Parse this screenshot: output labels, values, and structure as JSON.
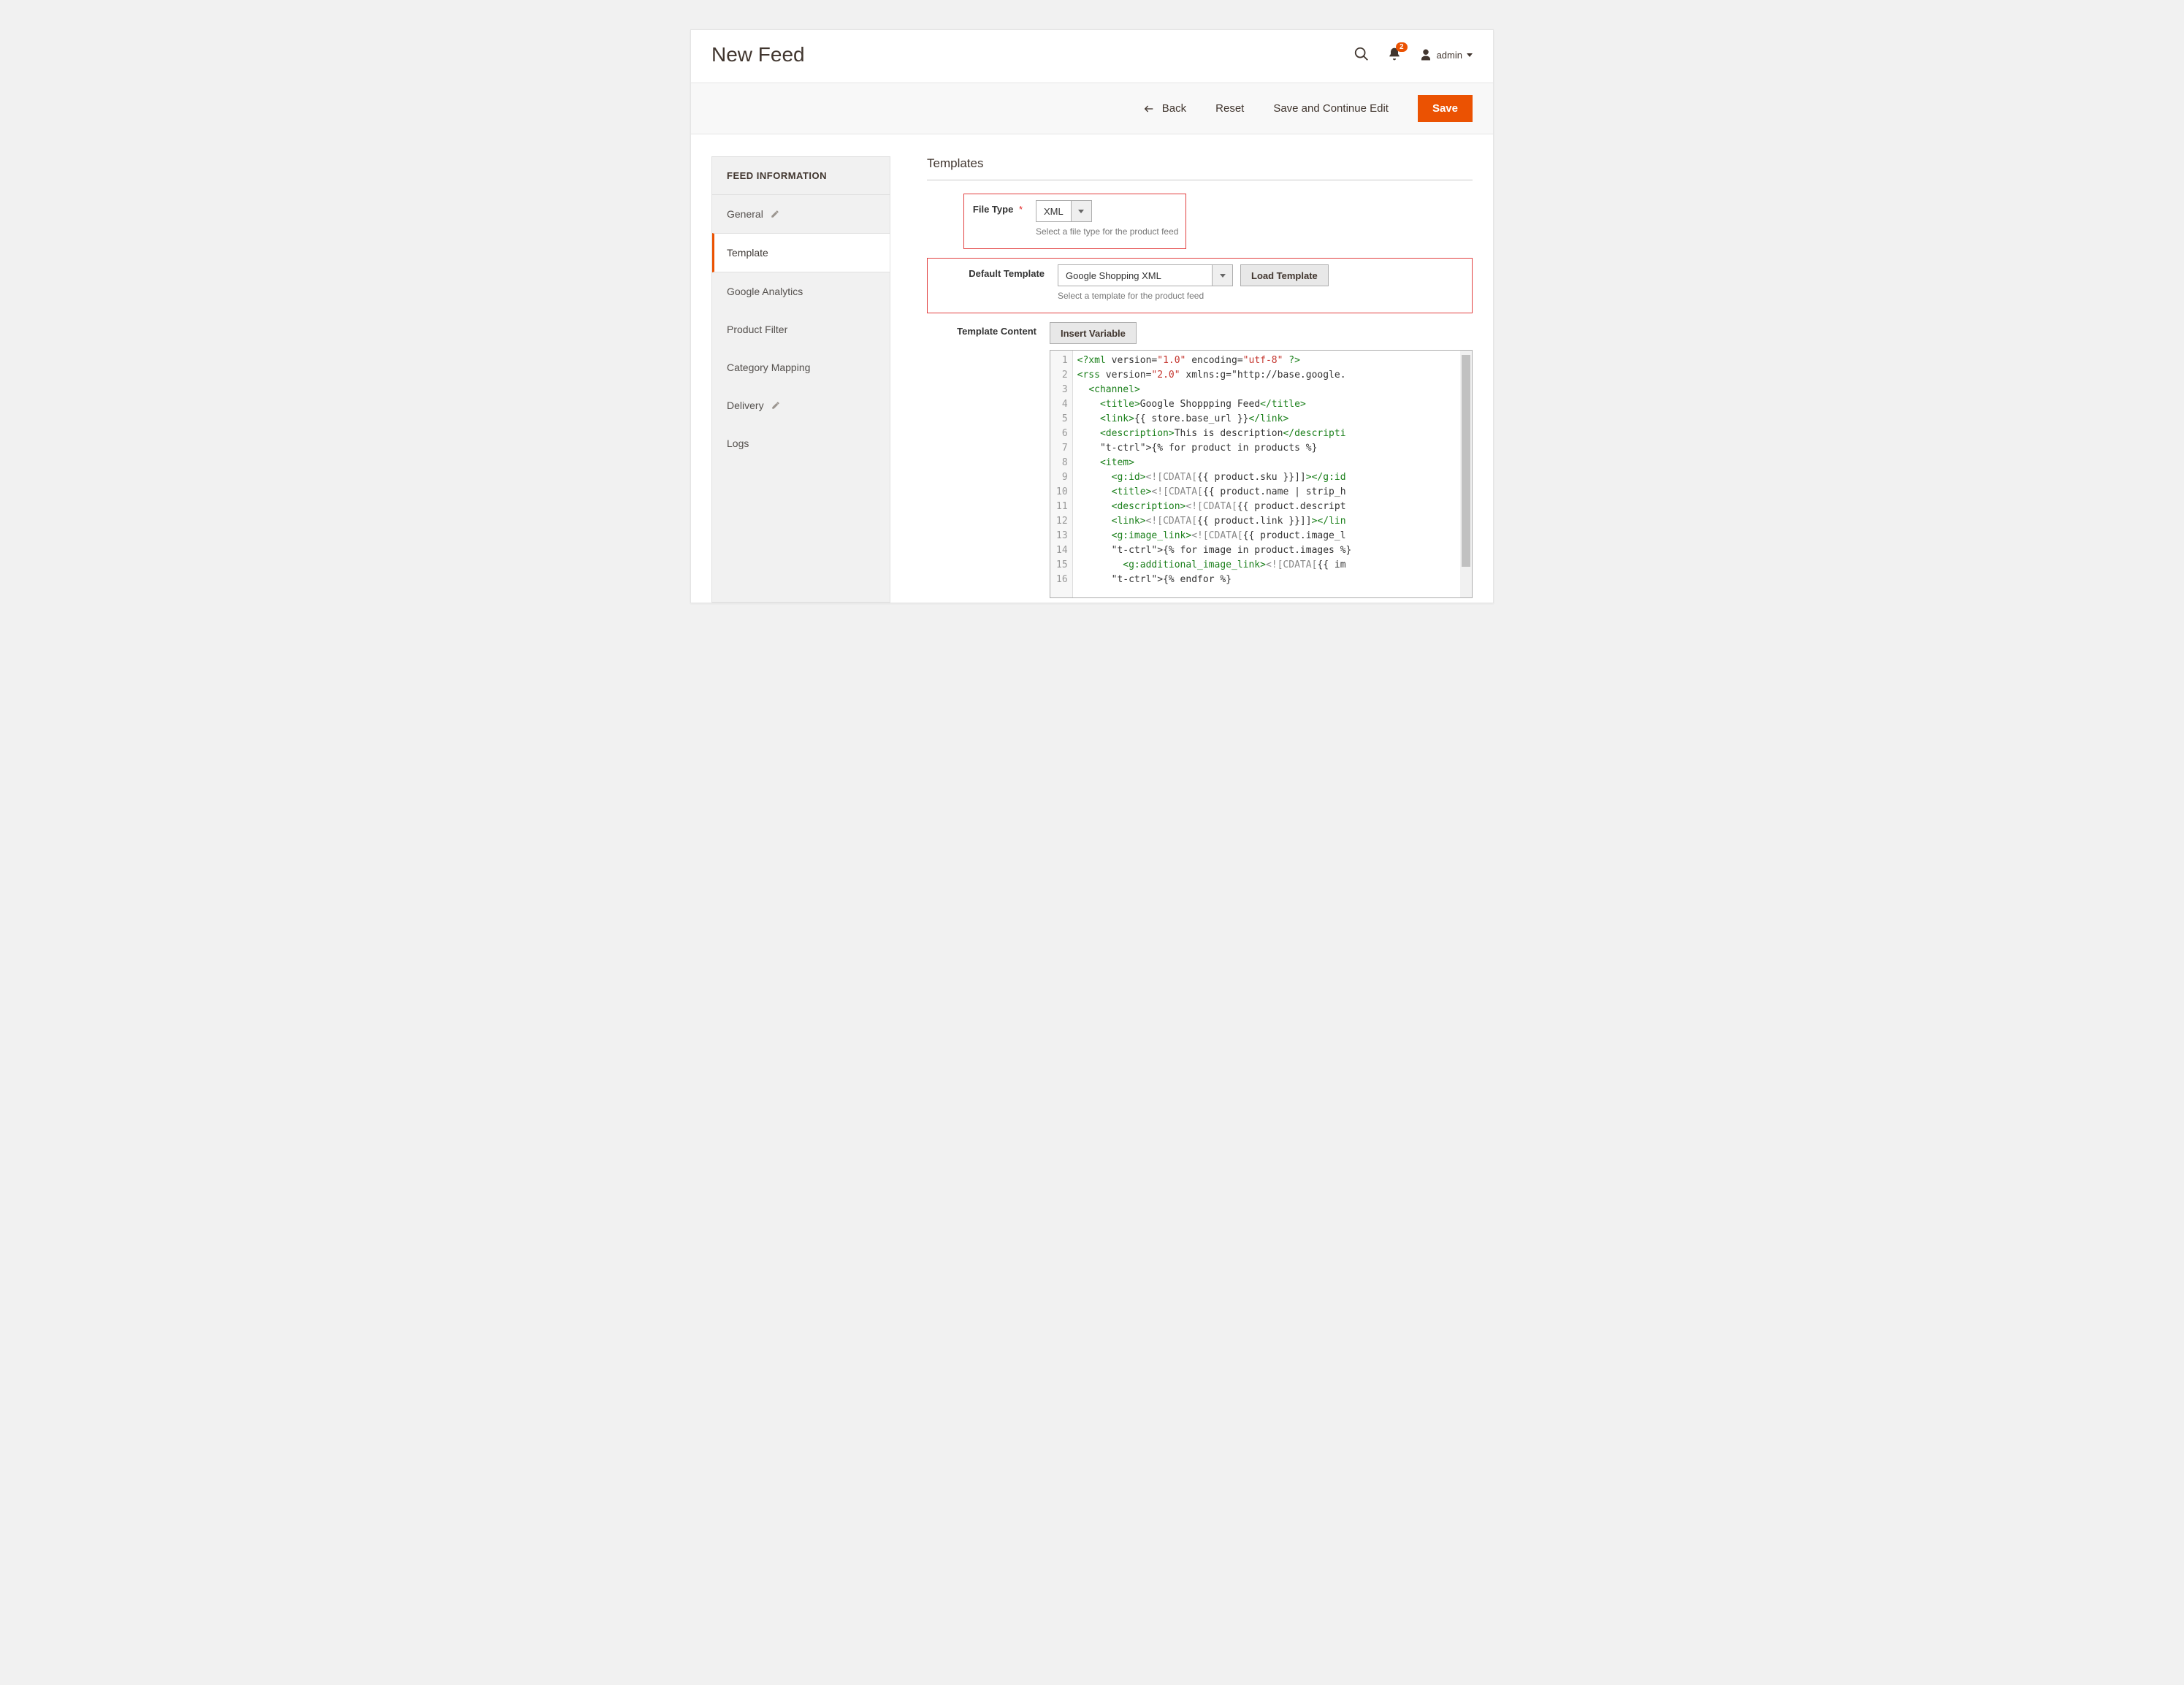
{
  "header": {
    "title": "New Feed",
    "notifications": "2",
    "user": "admin"
  },
  "actions": {
    "back": "Back",
    "reset": "Reset",
    "save_continue": "Save and Continue Edit",
    "save": "Save"
  },
  "sidebar": {
    "header": "FEED INFORMATION",
    "items": [
      {
        "label": "General",
        "editable": true
      },
      {
        "label": "Template",
        "active": true
      },
      {
        "label": "Google Analytics"
      },
      {
        "label": "Product Filter"
      },
      {
        "label": "Category Mapping"
      },
      {
        "label": "Delivery",
        "editable": true
      },
      {
        "label": "Logs"
      }
    ]
  },
  "section": {
    "title": "Templates",
    "file_type": {
      "label": "File Type",
      "value": "XML",
      "hint": "Select a file type for the product feed"
    },
    "default_template": {
      "label": "Default Template",
      "value": "Google Shopping XML",
      "button": "Load Template",
      "hint": "Select a template for the product feed"
    },
    "template_content": {
      "label": "Template Content",
      "insert_button": "Insert Variable"
    }
  },
  "code_lines": [
    "<?xml version=\"1.0\" encoding=\"utf-8\" ?>",
    "<rss version=\"2.0\" xmlns:g=\"http://base.google.",
    "  <channel>",
    "    <title>Google Shoppping Feed</title>",
    "    <link>{{ store.base_url }}</link>",
    "    <description>This is description</descripti",
    "    {% for product in products %}",
    "    <item>",
    "      <g:id><![CDATA[{{ product.sku }}]]></g:id",
    "      <title><![CDATA[{{ product.name | strip_h",
    "      <description><![CDATA[{{ product.descript",
    "      <link><![CDATA[{{ product.link }}]]></lin",
    "      <g:image_link><![CDATA[{{ product.image_l",
    "      {% for image in product.images %}",
    "        <g:additional_image_link><![CDATA[{{ im",
    "      {% endfor %}"
  ]
}
